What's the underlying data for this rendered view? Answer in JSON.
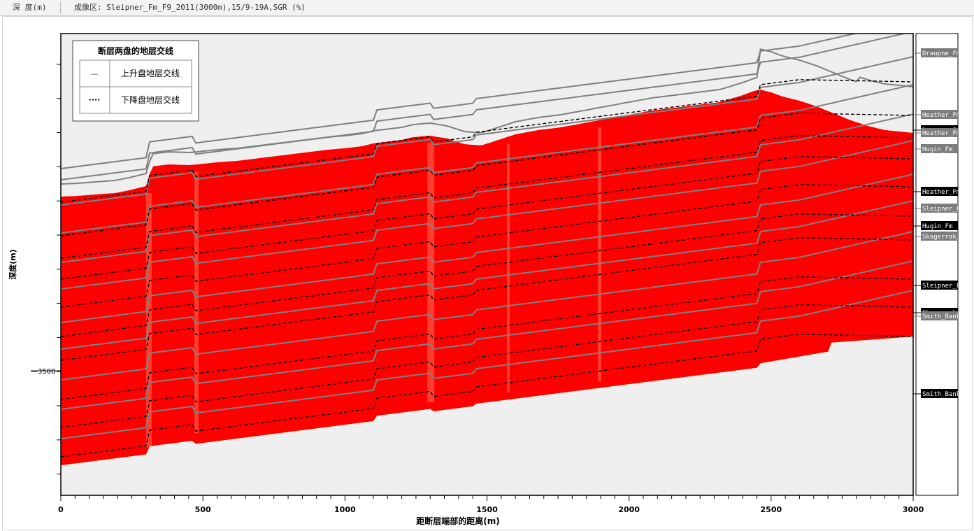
{
  "header": {
    "depth_label": "深 度(m)",
    "imaging_label": "成像区: Sleipner_Fm_F9_2011(3000m),15/9-19A,SGR (%)"
  },
  "legend": {
    "title": "断层两盘的地层交线",
    "items": [
      {
        "symbol": "—",
        "label": "上升盘地层交线"
      },
      {
        "symbol": "····",
        "label": "下降盘地层交线"
      }
    ]
  },
  "chart_data": {
    "type": "heatmap",
    "title": "",
    "xlabel": "距断层端部的距离(m)",
    "ylabel": "深度(m)",
    "xlim": [
      0,
      3000
    ],
    "x_ticks": [
      0,
      500,
      1000,
      1500,
      2000,
      2500,
      3000
    ],
    "y_tick_labels": [
      {
        "value": -3500,
        "label": "—3500"
      }
    ],
    "grid": false,
    "legend_position": "top-left",
    "colors": {
      "red": "#ff0000",
      "orange": "#ff6a2e",
      "salmon": "#fbb086",
      "yellow": "#ffff00",
      "green": "#00ff00",
      "background": "#efefef",
      "upthrown_line": "#808080",
      "downthrown_line": "#000000"
    },
    "horizon_labels": [
      {
        "name": "Draupne_Fm",
        "style": "upthrown"
      },
      {
        "name": "Heather_Fm",
        "style": "upthrown"
      },
      {
        "name": "Draupne_Fm",
        "style": "downthrown"
      },
      {
        "name": "Heather_Fm",
        "style": "upthrown"
      },
      {
        "name": "Hugin_Fm",
        "style": "upthrown"
      },
      {
        "name": "Heather_Fm",
        "style": "downthrown"
      },
      {
        "name": "Sleipner_Fm",
        "style": "upthrown"
      },
      {
        "name": "Hugin_Fm",
        "style": "downthrown"
      },
      {
        "name": "Skagerrak_Fm",
        "style": "upthrown"
      },
      {
        "name": "Sleipner_Fm",
        "style": "downthrown"
      },
      {
        "name": "Skagerrak_Fm",
        "style": "downthrown"
      },
      {
        "name": "Smith_Bank_Fm",
        "style": "upthrown"
      },
      {
        "name": "Smith_Bank_Fm",
        "style": "downthrown"
      }
    ]
  }
}
